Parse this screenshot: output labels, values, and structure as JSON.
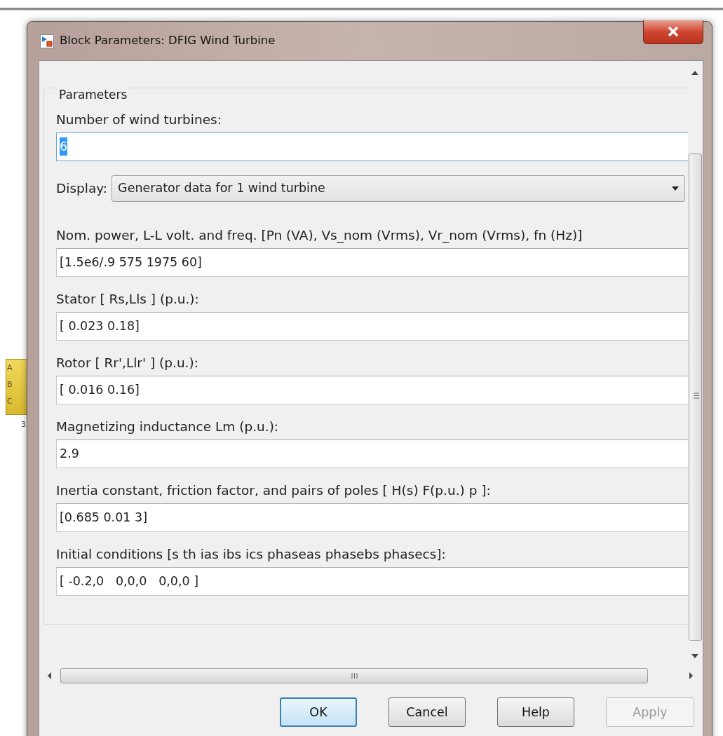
{
  "background_block": {
    "port_labels": [
      "A",
      "B",
      "C"
    ],
    "number": "3"
  },
  "window": {
    "title": "Block Parameters: DFIG Wind Turbine"
  },
  "group": {
    "legend": "Parameters"
  },
  "fields": [
    {
      "kind": "text",
      "label": "Number of wind turbines:",
      "value": "6",
      "focused": true
    },
    {
      "kind": "select",
      "label": "Display:",
      "value": "Generator data for 1 wind turbine",
      "focused": false
    },
    {
      "kind": "text",
      "label": "Nom. power, L-L volt. and freq. [Pn (VA), Vs_nom (Vrms), Vr_nom (Vrms), fn (Hz)]",
      "value": "[1.5e6/.9 575 1975 60]",
      "focused": false
    },
    {
      "kind": "text",
      "label": "Stator [ Rs,Lls ] (p.u.):",
      "value": "[ 0.023 0.18]",
      "focused": false
    },
    {
      "kind": "text",
      "label": "Rotor [ Rr',Llr' ] (p.u.):",
      "value": "[ 0.016 0.16]",
      "focused": false
    },
    {
      "kind": "text",
      "label": "Magnetizing inductance Lm (p.u.):",
      "value": "2.9",
      "focused": false
    },
    {
      "kind": "text",
      "label": "Inertia constant, friction factor, and pairs of poles [ H(s)  F(p.u.)  p ]:",
      "value": "[0.685 0.01 3]",
      "focused": false
    },
    {
      "kind": "text",
      "label": "Initial conditions [s  th  ias  ibs  ics  phaseas phasebs phasecs]:",
      "value": "[ -0.2,0   0,0,0   0,0,0 ]",
      "focused": false
    }
  ],
  "buttons": [
    {
      "label": "OK",
      "default": true,
      "disabled": false
    },
    {
      "label": "Cancel",
      "default": false,
      "disabled": false
    },
    {
      "label": "Help",
      "default": false,
      "disabled": false
    },
    {
      "label": "Apply",
      "default": false,
      "disabled": true
    }
  ]
}
